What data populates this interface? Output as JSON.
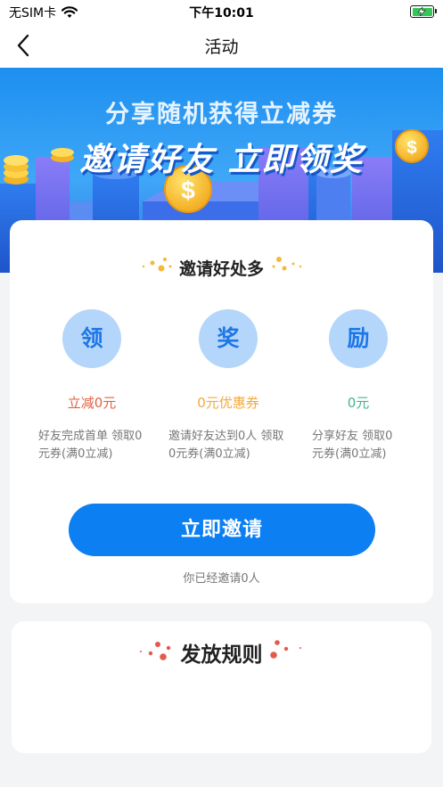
{
  "status_bar": {
    "carrier": "无SIM卡",
    "time": "下午10:01",
    "wifi_icon": "wifi-icon",
    "battery_icon": "battery-charging-icon",
    "battery_color": "#34c759"
  },
  "nav": {
    "title": "活动",
    "back_icon": "chevron-left-icon"
  },
  "banner": {
    "subtitle": "分享随机获得立减券",
    "headline": "邀请好友 立即领奖"
  },
  "invite_section": {
    "title": "邀请好处多",
    "rewards": [
      {
        "glyph": "领",
        "value": "立减0元",
        "value_color": "#e0623f",
        "description": [
          "好友完成首单 领取0",
          "元券(满0立减)"
        ]
      },
      {
        "glyph": "奖",
        "value": "0元优惠券",
        "value_color": "#f2a93b",
        "description": [
          "邀请好友达到0人 领取",
          "0元券(满0立减)"
        ]
      },
      {
        "glyph": "励",
        "value": "0元",
        "value_color": "#45b58a",
        "description": [
          "分享好友 领取0",
          "元券(满0立减)"
        ]
      }
    ],
    "button_label": "立即邀请",
    "invited_text": "你已经邀请0人"
  },
  "rules_section": {
    "title": "发放规则"
  },
  "colors": {
    "primary": "#0c7ff2",
    "circle_bg": "#b5d6fb",
    "page_bg": "#f3f4f6"
  }
}
